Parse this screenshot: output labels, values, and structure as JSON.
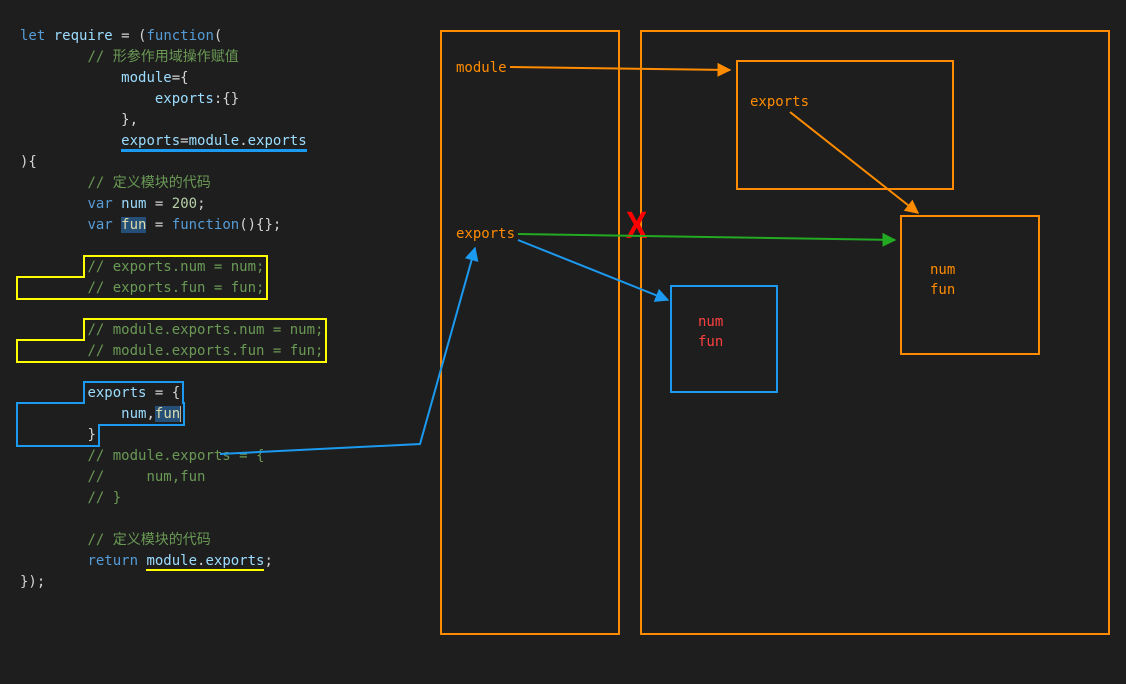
{
  "code": {
    "l1_let": "let",
    "l1_req": "require",
    "l1_rest": " = (",
    "l1_fn": "function",
    "l1_paren": "(",
    "l2_comment": "// 形参作用域操作赋值",
    "l3_mod": "module",
    "l3_rest": "={",
    "l4_exp": "exports",
    "l4_rest": ":{}",
    "l5": "},",
    "l6_exp": "exports",
    "l6_eq": "=",
    "l6_mod": "module",
    "l6_dot": ".",
    "l6_exp2": "exports",
    "l7": "){",
    "l8_comment": "// 定义模块的代码",
    "l9_var": "var",
    "l9_num": "num",
    "l9_eq": " = ",
    "l9_val": "200",
    "l9_semi": ";",
    "l10_var": "var",
    "l10_fun": "fun",
    "l10_eq": " = ",
    "l10_fn": "function",
    "l10_rest": "(){};",
    "l12_c1": "// exports.num = num;",
    "l12_c2": "// exports.fun = fun;",
    "l14_c1": "// module.exports.num = num;",
    "l14_c2": "// module.exports.fun = fun;",
    "l16_exp": "exports",
    "l16_rest": " = {",
    "l17_num": "num",
    "l17_comma": ",",
    "l17_fun": "fun",
    "l18": "}",
    "l19_c1": "// module.exports = {",
    "l19_c2": "//     num,fun",
    "l19_c3": "// }",
    "l21_comment": "// 定义模块的代码",
    "l22_ret": "return",
    "l22_mod": "module",
    "l22_dot": ".",
    "l22_exp": "exports",
    "l22_semi": ";",
    "l23": "});"
  },
  "diagram": {
    "module_label": "module",
    "exports_label": "exports",
    "exports_label2": "exports",
    "num_label": "num",
    "fun_label": "fun",
    "num_label2": "num",
    "fun_label2": "fun"
  }
}
